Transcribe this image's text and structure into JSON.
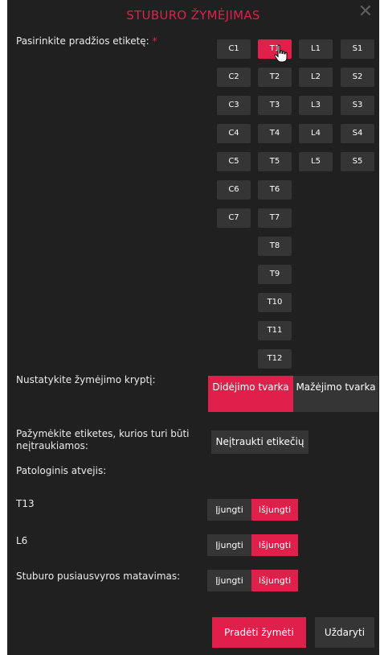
{
  "dialog": {
    "title": "STUBURO ŽYMĖJIMAS",
    "close_icon": "close-icon",
    "accent_color": "#e0204a"
  },
  "start_label": {
    "text": "Pasirinkite pradžios etiketę:",
    "required_mark": "*"
  },
  "vertebrae": {
    "cervical": [
      "C1",
      "C2",
      "C3",
      "C4",
      "C5",
      "C6",
      "C7"
    ],
    "thoracic": [
      "T1",
      "T2",
      "T3",
      "T4",
      "T5",
      "T6",
      "T7",
      "T8",
      "T9",
      "T10",
      "T11",
      "T12"
    ],
    "lumbar": [
      "L1",
      "L2",
      "L3",
      "L4",
      "L5"
    ],
    "sacral": [
      "S1",
      "S2",
      "S3",
      "S4",
      "S5"
    ],
    "selected": "T1"
  },
  "direction": {
    "label": "Nustatykite žymėjimo kryptį:",
    "ascending": "Didėjimo tvarka",
    "descending": "Mažėjimo tvarka",
    "selected": "ascending"
  },
  "exclude": {
    "label": "Pažymėkite etiketes, kurios turi būti neįtraukiamos:",
    "button": "Neįtraukti etikečių"
  },
  "pathology": {
    "label": "Patologinis atvejis:"
  },
  "toggles": {
    "on_label": "Įjungti",
    "off_label": "Išjungti",
    "t13": {
      "label": "T13",
      "state": "off"
    },
    "l6": {
      "label": "L6",
      "state": "off"
    },
    "balance": {
      "label": "Stuburo pusiausvyros matavimas:",
      "state": "off"
    }
  },
  "footer": {
    "start": "Pradėti žymėti",
    "close": "Uždaryti"
  }
}
